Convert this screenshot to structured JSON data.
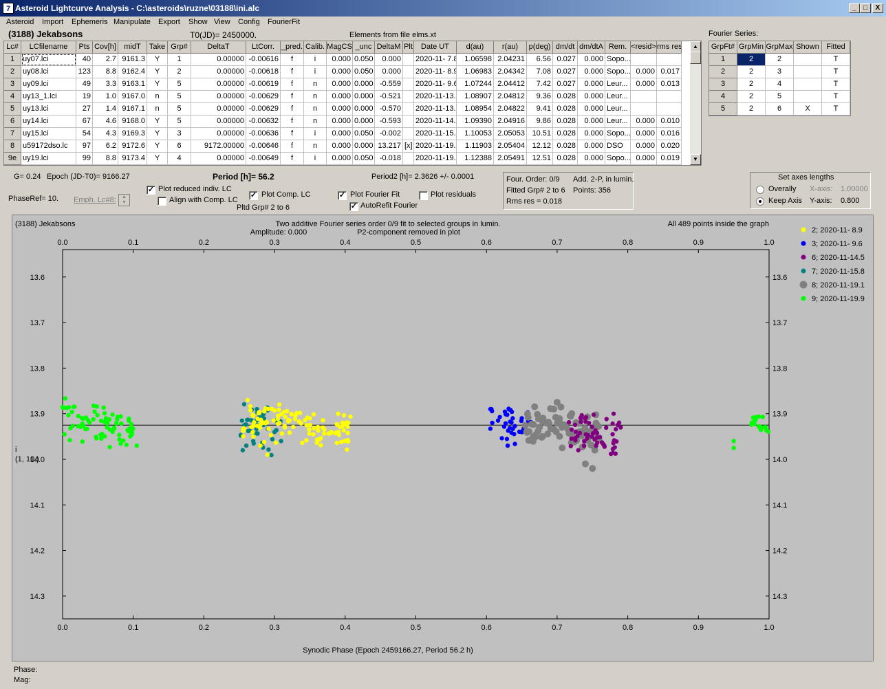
{
  "window": {
    "title": "Asteroid Lightcurve Analysis - C:\\asteroids\\ruzne\\03188\\ini.alc",
    "icon": "app-icon",
    "min": "_",
    "max": "□",
    "close": "X"
  },
  "menu": [
    "Asteroid",
    "Import",
    "Ephemeris",
    "Manipulate",
    "Export",
    "Show",
    "View",
    "Config",
    "FourierFit"
  ],
  "header": {
    "asteroid": "(3188) Jekabsons",
    "t0": "T0(JD)= 2450000.",
    "elements": "Elements from file elms.xt",
    "fourier_title": "Fourier Series:"
  },
  "lc_table": {
    "columns": [
      "Lc#",
      "LCfilename",
      "Pts",
      "Cov[h]",
      "midT",
      "Take",
      "Grp#",
      "DeltaT",
      "LtCorr.",
      "_pred.",
      "Calib.",
      "MagCS",
      "_unc",
      "DeltaM",
      "Plt",
      "Date UT",
      "d(au)",
      "r(au)",
      "p(deg)",
      "dm/dt",
      "dm/dtA",
      "Rem.",
      "<resid>",
      "rms res"
    ],
    "rows": [
      [
        "1",
        "uy07.lci",
        "40",
        "2.7",
        "9161.3",
        "Y",
        "1",
        "0.00000",
        "-0.00616",
        "f",
        "i",
        "0.000",
        "0.050",
        "0.000",
        "",
        "2020-11- 7.8",
        "1.06598",
        "2.04231",
        "6.56",
        "0.027",
        "0.000",
        "Sopo...",
        "",
        ""
      ],
      [
        "2",
        "uy08.lci",
        "123",
        "8.8",
        "9162.4",
        "Y",
        "2",
        "0.00000",
        "-0.00618",
        "f",
        "i",
        "0.000",
        "0.050",
        "0.000",
        "",
        "2020-11- 8.9",
        "1.06983",
        "2.04342",
        "7.08",
        "0.027",
        "0.000",
        "Sopo...",
        "0.000",
        "0.017"
      ],
      [
        "3",
        "uy09.lci",
        "49",
        "3.3",
        "9163.1",
        "Y",
        "5",
        "0.00000",
        "-0.00619",
        "f",
        "n",
        "0.000",
        "0.000",
        "-0.559",
        "",
        "2020-11- 9.6",
        "1.07244",
        "2.04412",
        "7.42",
        "0.027",
        "0.000",
        "Leur...",
        "0.000",
        "0.013"
      ],
      [
        "4",
        "uy13_1.lci",
        "19",
        "1.0",
        "9167.0",
        "n",
        "5",
        "0.00000",
        "-0.00629",
        "f",
        "n",
        "0.000",
        "0.000",
        "-0.521",
        "",
        "2020-11-13.5",
        "1.08907",
        "2.04812",
        "9.36",
        "0.028",
        "0.000",
        "Leur...",
        "",
        ""
      ],
      [
        "5",
        "uy13.lci",
        "27",
        "1.4",
        "9167.1",
        "n",
        "5",
        "0.00000",
        "-0.00629",
        "f",
        "n",
        "0.000",
        "0.000",
        "-0.570",
        "",
        "2020-11-13.6",
        "1.08954",
        "2.04822",
        "9.41",
        "0.028",
        "0.000",
        "Leur...",
        "",
        ""
      ],
      [
        "6",
        "uy14.lci",
        "67",
        "4.6",
        "9168.0",
        "Y",
        "5",
        "0.00000",
        "-0.00632",
        "f",
        "n",
        "0.000",
        "0.000",
        "-0.593",
        "",
        "2020-11-14.5",
        "1.09390",
        "2.04916",
        "9.86",
        "0.028",
        "0.000",
        "Leur...",
        "0.000",
        "0.010"
      ],
      [
        "7",
        "uy15.lci",
        "54",
        "4.3",
        "9169.3",
        "Y",
        "3",
        "0.00000",
        "-0.00636",
        "f",
        "i",
        "0.000",
        "0.050",
        "-0.002",
        "",
        "2020-11-15.8",
        "1.10053",
        "2.05053",
        "10.51",
        "0.028",
        "0.000",
        "Sopo...",
        "0.000",
        "0.016"
      ],
      [
        "8",
        "u59172dso.lc",
        "97",
        "6.2",
        "9172.6",
        "Y",
        "6",
        "9172.00000",
        "-0.00646",
        "f",
        "n",
        "0.000",
        "0.000",
        "13.217",
        "[x]",
        "2020-11-19.1",
        "1.11903",
        "2.05404",
        "12.12",
        "0.028",
        "0.000",
        "DSO",
        "0.000",
        "0.020"
      ],
      [
        "9e",
        "uy19.lci",
        "99",
        "8.8",
        "9173.4",
        "Y",
        "4",
        "0.00000",
        "-0.00649",
        "f",
        "i",
        "0.000",
        "0.050",
        "-0.018",
        "",
        "2020-11-19.9",
        "1.12388",
        "2.05491",
        "12.51",
        "0.028",
        "0.000",
        "Sopo...",
        "0.000",
        "0.019"
      ]
    ]
  },
  "fourier_table": {
    "columns": [
      "GrpFt#",
      "GrpMin",
      "GrpMax",
      "Shown",
      "Fitted"
    ],
    "rows": [
      [
        "1",
        "2",
        "2",
        "",
        "T"
      ],
      [
        "2",
        "2",
        "3",
        "",
        "T"
      ],
      [
        "3",
        "2",
        "4",
        "",
        "T"
      ],
      [
        "4",
        "2",
        "5",
        "",
        "T"
      ],
      [
        "5",
        "2",
        "6",
        "X",
        "T"
      ]
    ]
  },
  "controls": {
    "g": "G= 0.24",
    "epoch": "Epoch (JD-T0)= 9166.27",
    "period": "Period [h]= 56.2",
    "period2": "Period2 [h]= 2.3626 +/- 0.0001",
    "phaseref": "PhaseRef= 10.",
    "emph": "Emph. Lc#8:",
    "plot_reduced": "Plot reduced indiv. LC",
    "align": "Align with Comp. LC",
    "plot_comp": "Plot Comp. LC",
    "pltd": "Pltd Grp#  2   to   6",
    "plot_fourier": "Plot Fourier Fit",
    "autorefit": "AutoRefit Fourier",
    "plot_residuals": "Plot residuals",
    "info1": "Four. Order:  0/9",
    "info2": "Add. 2-P, in lumin.",
    "info3": "Fitted Grp# 2 to 6",
    "info4": "Points: 356",
    "info5": "Rms res      = 0.018",
    "axes_title": "Set axes lengths",
    "overally": "Overally",
    "keep_axis": "Keep Axis",
    "xaxis_lbl": "X-axis:",
    "xaxis_val": "1.00000",
    "yaxis_lbl": "Y-axis:",
    "yaxis_val": "0.800"
  },
  "plot_text": {
    "name": "(3188) Jekabsons",
    "line1": "Two additive Fourier series order 0/9 fit to selected groups in lumin.",
    "line2a": "Amplitude: 0.000",
    "line2b": "P2-component removed in plot",
    "points_inside": "All 489 points inside the graph",
    "ylabel1": "i",
    "ylabel2": "(1, 10.)",
    "xlabel": "Synodic Phase (Epoch 2459166.27, Period 56.2 h)",
    "phase_lbl": "Phase:",
    "mag_lbl": "Mag:"
  },
  "chart_data": {
    "type": "scatter",
    "xlabel": "Synodic Phase (Epoch 2459166.27, Period 56.2 h)",
    "ylabel": "i (1, 10.)",
    "xlim": [
      0,
      1
    ],
    "ylim": [
      14.35,
      13.54
    ],
    "x_ticks": [
      "0.0",
      "0.1",
      "0.2",
      "0.3",
      "0.4",
      "0.5",
      "0.6",
      "0.7",
      "0.8",
      "0.9",
      "1.0"
    ],
    "y_ticks": [
      "13.6",
      "13.7",
      "13.8",
      "13.9",
      "14.0",
      "14.1",
      "14.2",
      "14.3"
    ],
    "fit_level": 13.925,
    "legend_position": "right",
    "series": [
      {
        "name": "2; 2020-11- 8.9",
        "color": "#ffff00",
        "ranges": [
          [
            0.255,
            0.41,
            13.89,
            13.96
          ]
        ],
        "points": [
          [
            0.262,
            13.87
          ],
          [
            0.28,
            13.97
          ],
          [
            0.29,
            13.99
          ],
          [
            0.27,
            13.95
          ],
          [
            0.35,
            13.91
          ],
          [
            0.39,
            13.9
          ]
        ]
      },
      {
        "name": "3; 2020-11- 9.6",
        "color": "#0000ff",
        "ranges": [
          [
            0.605,
            0.665,
            13.89,
            13.96
          ]
        ],
        "points": [
          [
            0.607,
            13.89
          ],
          [
            0.63,
            13.97
          ],
          [
            0.65,
            13.91
          ]
        ]
      },
      {
        "name": "6; 2020-11-14.5",
        "color": "#800080",
        "ranges": [
          [
            0.715,
            0.79,
            13.91,
            13.97
          ]
        ],
        "points": [
          [
            0.73,
            13.98
          ],
          [
            0.78,
            13.9
          ],
          [
            0.79,
            13.93
          ]
        ]
      },
      {
        "name": "7; 2020-11-15.8",
        "color": "#008080",
        "ranges": [
          [
            0.25,
            0.31,
            13.89,
            13.97
          ]
        ],
        "points": [
          [
            0.255,
            13.98
          ],
          [
            0.26,
            13.97
          ],
          [
            0.275,
            13.89
          ],
          [
            0.3,
            13.94
          ]
        ]
      },
      {
        "name": "8; 2020-11-19.1",
        "color": "#808080",
        "ranges": [
          [
            0.655,
            0.76,
            13.89,
            13.97
          ]
        ],
        "points": [
          [
            0.7,
            13.875
          ],
          [
            0.74,
            14.01
          ],
          [
            0.75,
            14.02
          ],
          [
            0.67,
            13.95
          ]
        ]
      },
      {
        "name": "9; 2020-11-19.9",
        "color": "#00ff00",
        "ranges": [
          [
            0.0,
            0.105,
            13.89,
            13.96
          ],
          [
            0.975,
            1.0,
            13.91,
            13.94
          ]
        ],
        "points": [
          [
            0.0,
            13.885
          ],
          [
            0.105,
            13.97
          ],
          [
            0.95,
            13.96
          ],
          [
            0.95,
            13.975
          ]
        ]
      }
    ]
  }
}
